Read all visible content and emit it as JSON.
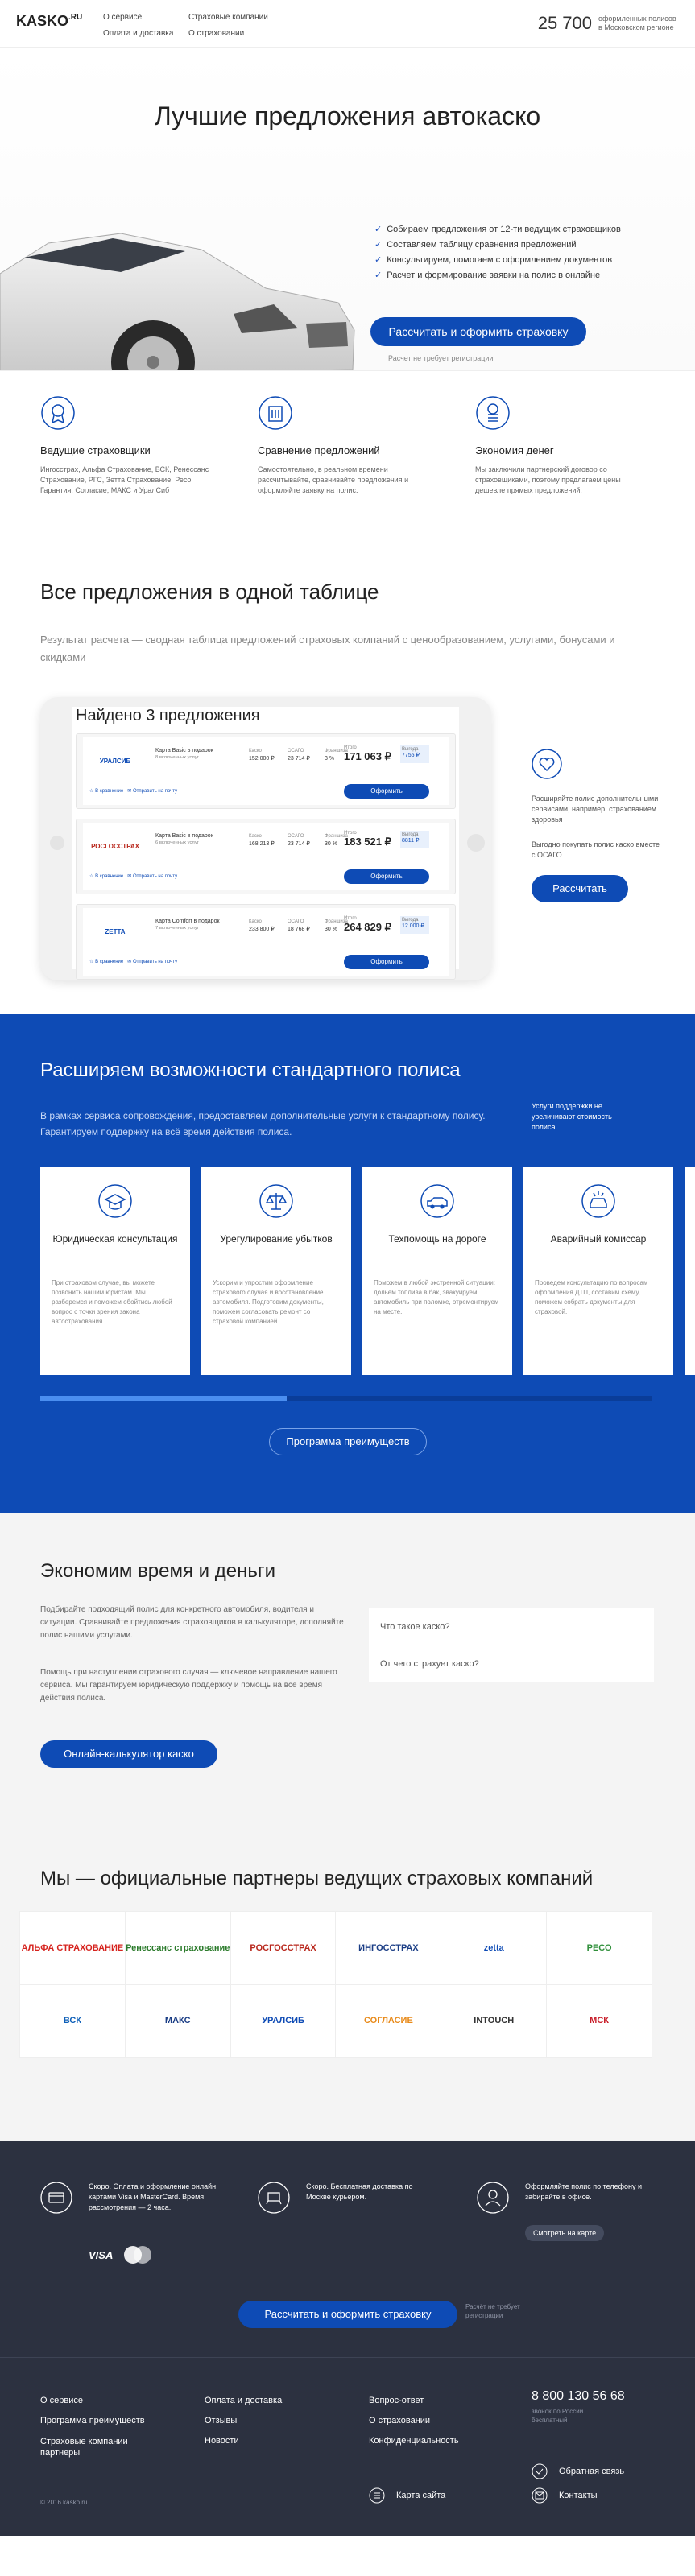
{
  "header": {
    "logo": "KASKO",
    "logo_sup": ".RU",
    "nav": [
      "О сервисе",
      "Оплата и доставка",
      "Страховые компании",
      "О страховании"
    ],
    "count": "25 700",
    "count_text": "оформленных полисов в Московском регионе"
  },
  "hero": {
    "title": "Лучшие предложения автокаско",
    "checks": [
      "Собираем предложения от 12-ти ведущих страховщиков",
      "Составляем таблицу сравнения предложений",
      "Консультируем, помогаем с оформлением документов",
      "Расчет и формирование заявки на полис в онлайне"
    ],
    "cta": "Рассчитать и оформить страховку",
    "note": "Расчет не требует регистрации"
  },
  "features": [
    {
      "title": "Ведущие страховщики",
      "text": "Ингосстрах, Альфа Страхование, ВСК, Ренессанс Страхование, РГС, Зетта Страхование, Ресо Гарантия, Согласие, МАКС и УралСиб"
    },
    {
      "title": "Сравнение предложений",
      "text": "Самостоятельно, в реальном времени рассчитывайте, сравнивайте предложения и оформляйте заявку на полис."
    },
    {
      "title": "Экономия денег",
      "text": "Мы заключили партнерский договор со страховщиками, поэтому предлагаем цены дешевле прямых предложений."
    }
  ],
  "offers_section": {
    "title": "Все предложения в одной таблице",
    "lead": "Результат расчета — сводная таблица предложений страховых компаний с ценообразованием, услугами, бонусами и скидками",
    "found": "Найдено 3 предложения",
    "offers": [
      {
        "logo": "УРАЛСИБ",
        "logo_color": "#0e4bb5",
        "title": "Карта Basic в подарок",
        "services": "8 включенных услуг",
        "kasko": "152 000 ₽",
        "osago": "23 714 ₽",
        "franchise": "3 %",
        "total": "171 063 ₽",
        "discount": "7755 ₽"
      },
      {
        "logo": "РОСГОССТРАХ",
        "logo_color": "#b8261b",
        "title": "Карта Basic в подарок",
        "services": "6 включенных услуг",
        "kasko": "168 213 ₽",
        "osago": "23 714 ₽",
        "franchise": "30 %",
        "total": "183 521 ₽",
        "discount": "8811 ₽"
      },
      {
        "logo": "ZETTA",
        "logo_color": "#0e4bb5",
        "title": "Карта Comfort в подарок",
        "services": "7 включенных услуг",
        "kasko": "233 800 ₽",
        "osago": "18 768 ₽",
        "franchise": "30 %",
        "total": "264 829 ₽",
        "discount": "12 000 ₽"
      }
    ],
    "col_labels": {
      "kasko": "Каско",
      "osago": "ОСАГО",
      "franchise": "Франшиза",
      "total": "Итого",
      "discount": "Выгода"
    },
    "compare": "В сравнение",
    "send": "Отправить на почту",
    "order": "Оформить",
    "side_text1": "Расширяйте полис дополнительными сервисами, например, страхованием здоровья",
    "side_text2": "Выгодно покупать полис каско вместе с ОСАГО",
    "side_btn": "Рассчитать"
  },
  "extend": {
    "title": "Расширяем возможности стандартного полиса",
    "lead": "В рамках сервиса сопровождения, предоставляем дополнительные услуги к стандартному полису. Гарантируем поддержку на всё время действия полиса.",
    "aside": "Услуги поддержки не увеличивают стоимость полиса",
    "cards": [
      {
        "title": "Юридическая консультация",
        "text": "При страховом случае, вы можете позвонить нашим юристам. Мы разберемся и поможем обойтись любой вопрос с точки зрения закона автострахования."
      },
      {
        "title": "Урегулирование убытков",
        "text": "Ускорим и упростим оформление страхового случая и восстановление автомобиля. Подготовим документы, поможем согласовать ремонт со страховой компанией."
      },
      {
        "title": "Техпомощь на дороге",
        "text": "Поможем в любой экстренной ситуации: дольем топлива в бак, эвакуируем автомобиль при поломке, отремонтируем на месте."
      },
      {
        "title": "Аварийный комиссар",
        "text": "Проведем консультацию по вопросам оформления ДТП, составим схему, поможем собрать документы для страховой."
      }
    ],
    "program_btn": "Программа преимуществ"
  },
  "economy": {
    "title": "Экономим время и деньги",
    "p1": "Подбирайте подходящий полис для конкретного автомобиля, водителя и ситуации. Сравнивайте предложения страховщиков в калькуляторе, дополняйте полис нашими услугами.",
    "p2": "Помощь при наступлении страхового случая — ключевое направление нашего сервиса. Мы гарантируем юридическую поддержку и помощь на все время действия полиса.",
    "btn": "Онлайн-калькулятор каско",
    "faq": [
      "Что такое каско?",
      "От чего страхует каско?"
    ]
  },
  "partners": {
    "title": "Мы — официальные партнеры ведущих страховых компаний",
    "logos": [
      {
        "name": "АЛЬФА СТРАХОВАНИЕ",
        "color": "#d6231e"
      },
      {
        "name": "Ренессанс страхование",
        "color": "#2a7a2a"
      },
      {
        "name": "РОСГОССТРАХ",
        "color": "#b8261b"
      },
      {
        "name": "ИНГОССТРАХ",
        "color": "#1a3d85"
      },
      {
        "name": "zetta",
        "color": "#0e4bb5"
      },
      {
        "name": "РЕСО",
        "color": "#2f8f3a"
      },
      {
        "name": "ВСК",
        "color": "#0d5fb8"
      },
      {
        "name": "МАКС",
        "color": "#1a3d85"
      },
      {
        "name": "УРАЛСИБ",
        "color": "#0e4bb5"
      },
      {
        "name": "СОГЛАСИЕ",
        "color": "#e88a1a"
      },
      {
        "name": "INTOUCH",
        "color": "#333333"
      },
      {
        "name": "МСК",
        "color": "#c81e2a"
      }
    ]
  },
  "footer": {
    "block1": "Скоро. Оплата и оформление онлайн картами Visa и MasterCard. Время рассмотрения — 2 часа.",
    "visa": "VISA",
    "block2": "Скоро. Бесплатная доставка по Москве курьером.",
    "block3": "Оформляйте полис по телефону и забирайте в офисе.",
    "map_btn": "Смотреть на карте",
    "cta": "Рассчитать и оформить страховку",
    "cta_note": "Расчёт не требует регистрации",
    "col1": [
      "О сервисе",
      "Программа преимуществ",
      "Страховые компании партнеры"
    ],
    "col2": [
      "Оплата и доставка",
      "Отзывы",
      "Новости"
    ],
    "col3": [
      "Вопрос-ответ",
      "О страховании",
      "Конфиденциальность"
    ],
    "phone": "8 800 130 56 68",
    "phone_note": "звонок по России бесплатный",
    "feedback": "Обратная связь",
    "sitemap": "Карта сайта",
    "contacts": "Контакты",
    "copyright": "© 2016 kasko.ru"
  }
}
